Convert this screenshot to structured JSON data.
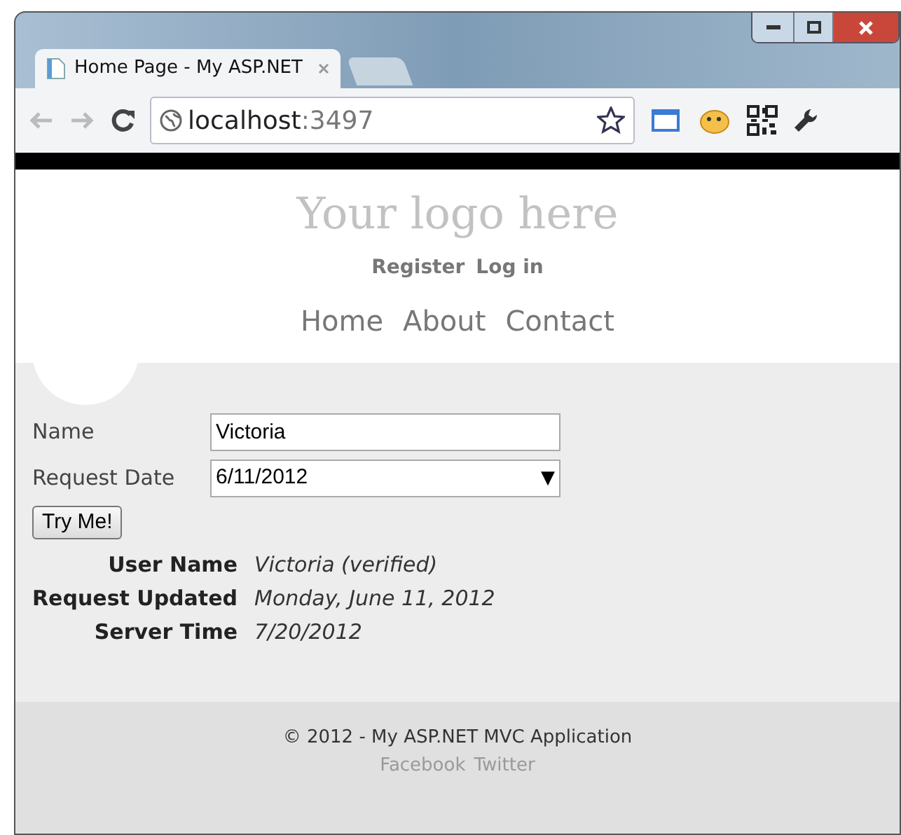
{
  "browser": {
    "tabs": [
      {
        "title": "Home Page - My ASP.NET",
        "selected": true
      }
    ],
    "address": {
      "host": "localhost",
      "port": ":3497"
    }
  },
  "header": {
    "logo": "Your logo here",
    "account_links": [
      "Register",
      "Log in"
    ],
    "menu": [
      "Home",
      "About",
      "Contact"
    ]
  },
  "form": {
    "fields": [
      {
        "label": "Name",
        "kind": "text",
        "value": "Victoria"
      },
      {
        "label": "Request Date",
        "kind": "select",
        "value": "6/11/2012",
        "arrow": "▼"
      }
    ],
    "button": "Try Me!"
  },
  "results": [
    {
      "label": "User Name",
      "value": "Victoria (verified)"
    },
    {
      "label": "Request Updated",
      "value": "Monday, June 11, 2012"
    },
    {
      "label": "Server Time",
      "value": "7/20/2012"
    }
  ],
  "footer": {
    "copyright": "© 2012 - My ASP.NET MVC Application",
    "links": [
      "Facebook",
      "Twitter"
    ]
  }
}
